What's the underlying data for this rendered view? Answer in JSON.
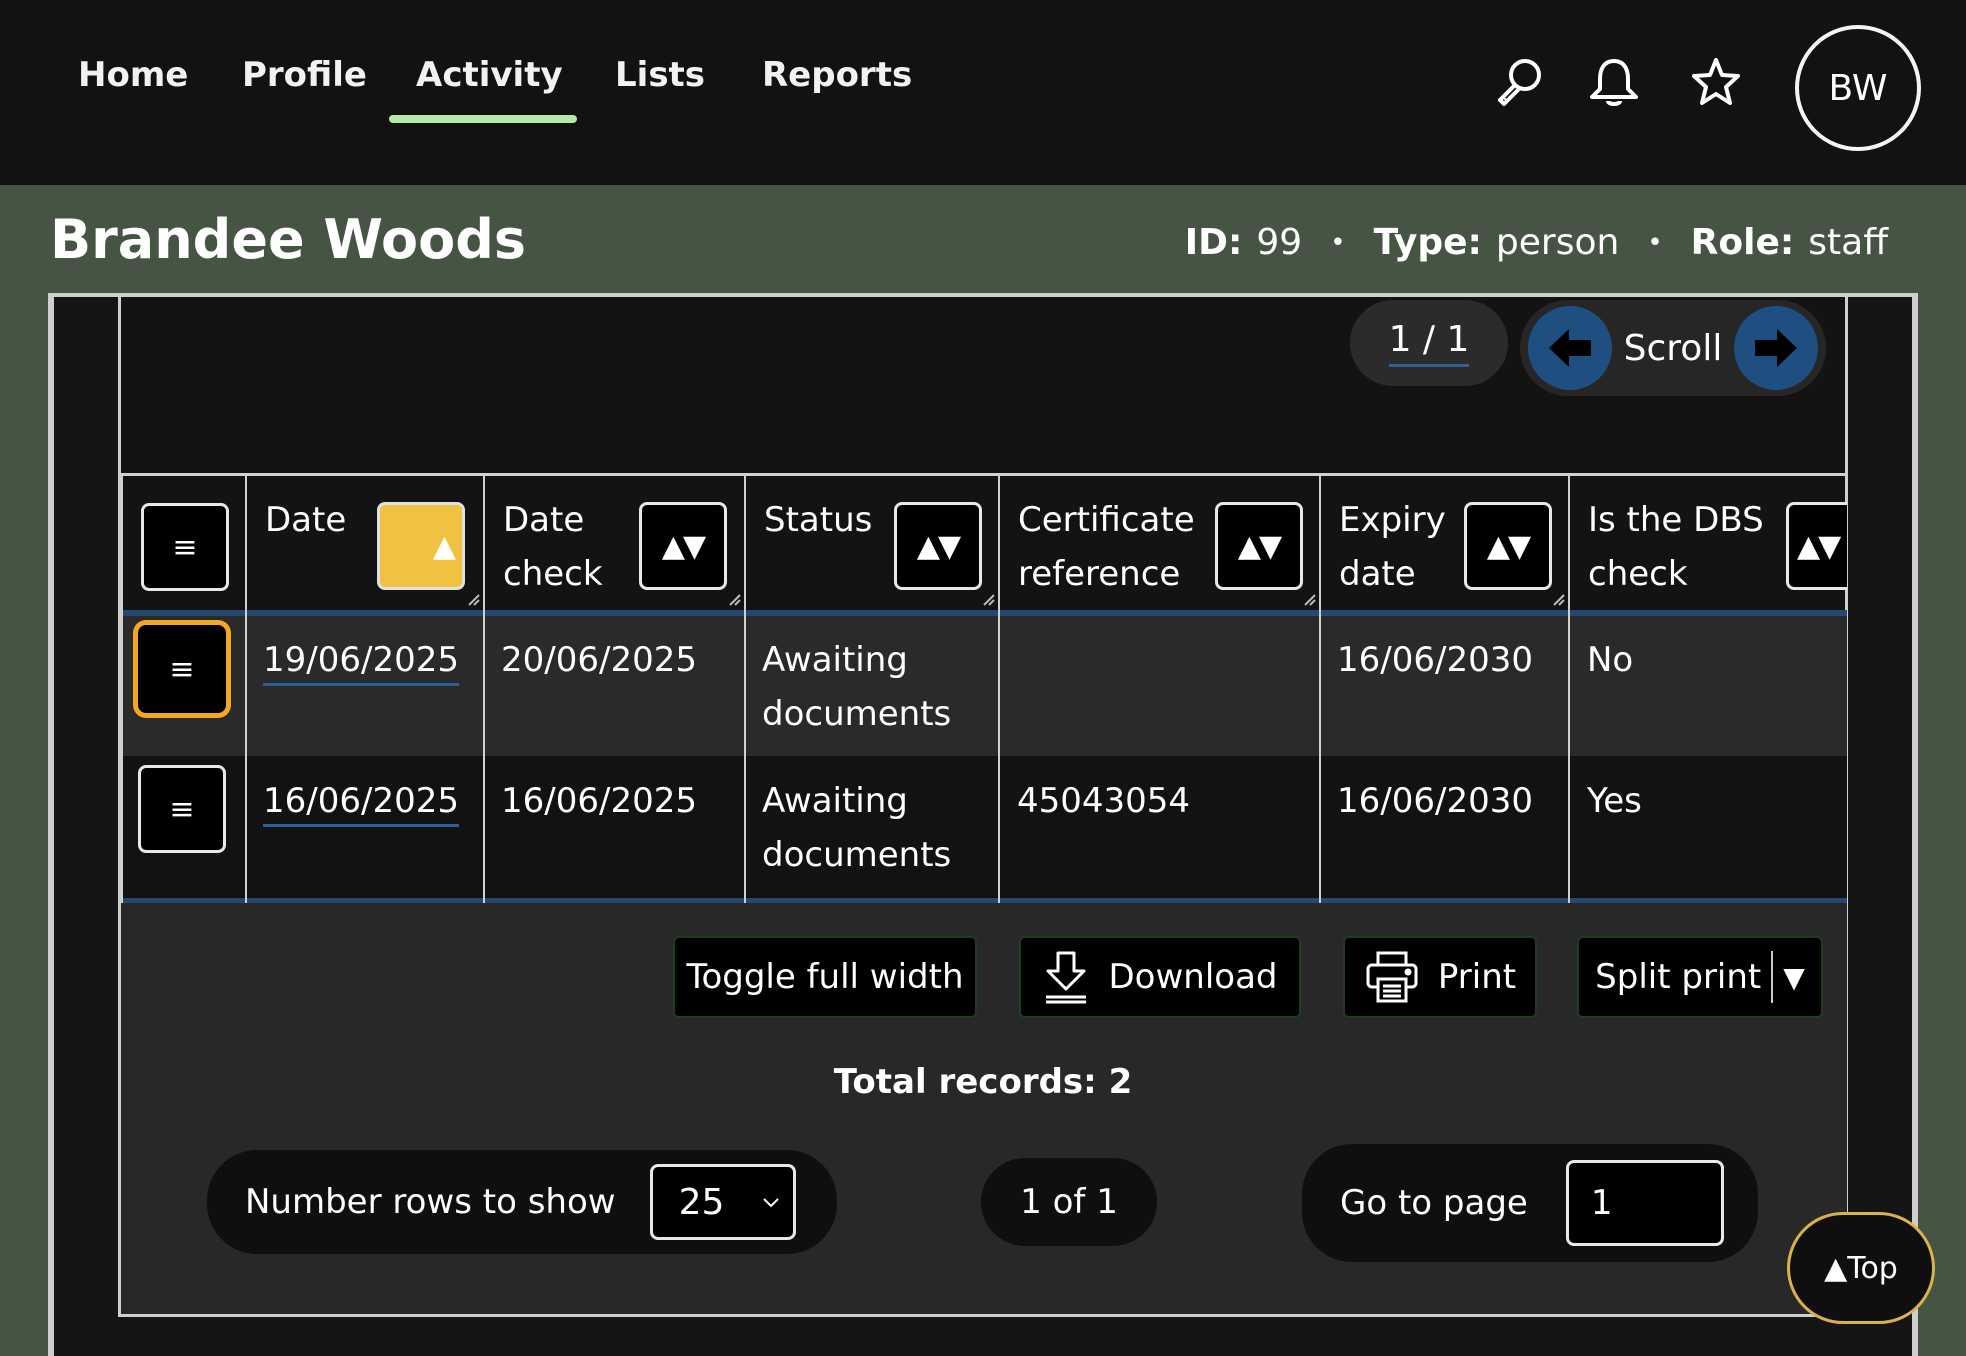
{
  "nav": {
    "items": [
      {
        "label": "Home"
      },
      {
        "label": "Profile"
      },
      {
        "label": "Activity"
      },
      {
        "label": "Lists"
      },
      {
        "label": "Reports"
      }
    ],
    "active": "Activity",
    "icons": [
      "search-icon",
      "bell-icon",
      "star-icon"
    ],
    "avatar_initials": "BW",
    "accent_color": "#b6e8a6"
  },
  "header": {
    "title": "Brandee Woods",
    "id_label": "ID:",
    "id_value": "99",
    "type_label": "Type:",
    "type_value": "person",
    "role_label": "Role:",
    "role_value": "staff"
  },
  "pager": {
    "page_indicator": "1 / 1",
    "scroll_label": "Scroll"
  },
  "table": {
    "columns": [
      {
        "label": "Date",
        "sort": "ascending"
      },
      {
        "label": "Date check",
        "sort": "none"
      },
      {
        "label": "Status",
        "sort": "none"
      },
      {
        "label": "Certificate reference",
        "sort": "none"
      },
      {
        "label": "Expiry date",
        "sort": "none"
      },
      {
        "label": "Is the DBS check",
        "sort": "none"
      }
    ],
    "rows": [
      {
        "date": "19/06/2025",
        "date_check": "20/06/2025",
        "status": "Awaiting documents",
        "certificate": "",
        "expiry": "16/06/2030",
        "dbs": "No"
      },
      {
        "date": "16/06/2025",
        "date_check": "16/06/2025",
        "status": "Awaiting documents",
        "certificate": "45043054",
        "expiry": "16/06/2030",
        "dbs": "Yes"
      }
    ],
    "row_menu_symbol": "≡",
    "sort_active_color": "#f0c242"
  },
  "actions": {
    "toggle_width": "Toggle full width",
    "download": "Download",
    "print": "Print",
    "split_print": "Split print"
  },
  "footer": {
    "total_records": "Total records: 2",
    "rows_label": "Number rows to show",
    "rows_value": "25",
    "page_status": "1 of 1",
    "goto_label": "Go to page",
    "goto_value": "1",
    "top_button": "▲Top"
  }
}
